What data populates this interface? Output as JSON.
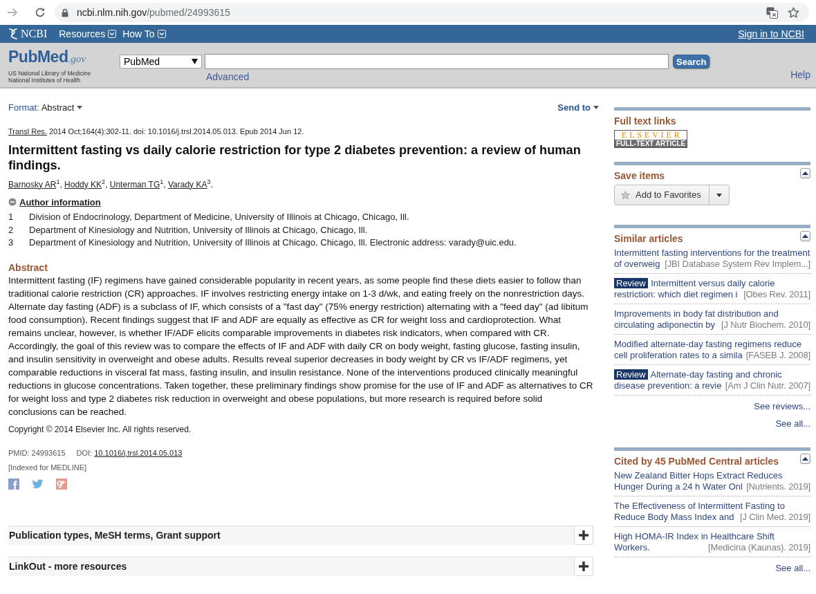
{
  "browser": {
    "forward": {
      "disabled": true
    },
    "address": {
      "host": "ncbi.nlm.nih.gov",
      "path": "/pubmed/24993615"
    }
  },
  "ncbi_bar": {
    "logo": "NCBI",
    "menus": [
      "Resources",
      "How To"
    ],
    "sign_in": "Sign in to NCBI"
  },
  "pubmed_header": {
    "logo": {
      "name": "PubMed",
      "suffix": ".gov",
      "lines": [
        "US National Library of Medicine",
        "National Institutes of Health"
      ]
    },
    "database": "PubMed",
    "search_button": "Search",
    "advanced": "Advanced",
    "help": "Help"
  },
  "toolbar": {
    "format_label": "Format:",
    "format_value": "Abstract",
    "send_to": "Send to"
  },
  "article": {
    "citation": {
      "journal": "Transl Res.",
      "details": "2014 Oct;164(4):302-11. doi: 10.1016/j.trsl.2014.05.013. Epub 2014 Jun 12."
    },
    "title": "Intermittent fasting vs daily calorie restriction for type 2 diabetes prevention: a review of human findings.",
    "authors": [
      {
        "name": "Barnosky AR",
        "affiliation": "1",
        "punctuation": ","
      },
      {
        "name": "Hoddy KK",
        "affiliation": "2",
        "punctuation": ","
      },
      {
        "name": "Unterman TG",
        "affiliation": "1",
        "punctuation": ","
      },
      {
        "name": "Varady KA",
        "affiliation": "3",
        "punctuation": "."
      }
    ],
    "author_information": {
      "label": "Author information",
      "expanded": true,
      "affiliations": [
        {
          "number": "1",
          "text": "Division of Endocrinology, Department of Medicine, University of Illinois at Chicago, Chicago, Ill."
        },
        {
          "number": "2",
          "text": "Department of Kinesiology and Nutrition, University of Illinois at Chicago, Chicago, Ill."
        },
        {
          "number": "3",
          "text": "Department of Kinesiology and Nutrition, University of Illinois at Chicago, Chicago, Ill. Electronic address: varady@uic.edu."
        }
      ]
    },
    "abstract": {
      "heading": "Abstract",
      "text": "Intermittent fasting (IF) regimens have gained considerable popularity in recent years, as some people find these diets easier to follow than traditional calorie restriction (CR) approaches. IF involves restricting energy intake on 1-3 d/wk, and eating freely on the nonrestriction days. Alternate day fasting (ADF) is a subclass of IF, which consists of a \"fast day\" (75% energy restriction) alternating with a \"feed day\" (ad libitum food consumption). Recent findings suggest that IF and ADF are equally as effective as CR for weight loss and cardioprotection. What remains unclear, however, is whether IF/ADF elicits comparable improvements in diabetes risk indicators, when compared with CR. Accordingly, the goal of this review was to compare the effects of IF and ADF with daily CR on body weight, fasting glucose, fasting insulin, and insulin sensitivity in overweight and obese adults. Results reveal superior decreases in body weight by CR vs IF/ADF regimens, yet comparable reductions in visceral fat mass, fasting insulin, and insulin resistance. None of the interventions produced clinically meaningful reductions in glucose concentrations. Taken together, these preliminary findings show promise for the use of IF and ADF as alternatives to CR for weight loss and type 2 diabetes risk reduction in overweight and obese populations, but more research is required before solid conclusions can be reached."
    },
    "copyright": "Copyright © 2014 Elsevier Inc. All rights reserved.",
    "pmid": "PMID: 24993615",
    "doi": {
      "label": "DOI:",
      "value": "10.1016/j.trsl.2014.05.013"
    },
    "indexed": "[Indexed for MEDLINE]"
  },
  "sections": [
    {
      "title": "Publication types, MeSH terms, Grant support",
      "expanded": false
    },
    {
      "title": "LinkOut - more resources",
      "expanded": false
    }
  ],
  "sidebar": {
    "full_text": {
      "heading": "Full text links",
      "publisher": "ELSEVIER",
      "caption": "FULL-TEXT ARTICLE"
    },
    "save_items": {
      "heading": "Save items",
      "expanded": true,
      "button": "Add to Favorites"
    },
    "similar": {
      "heading": "Similar articles",
      "expanded": true,
      "items": [
        {
          "title": "Intermittent fasting interventions for the treatment of overweig",
          "source": "[JBI Database System Rev Implem...]"
        },
        {
          "badge": "Review",
          "title": "Intermittent versus daily calorie restriction: which diet regimen i",
          "source": "[Obes Rev. 2011]"
        },
        {
          "title": "Improvements in body fat distribution and circulating adiponectin by",
          "source": "[J Nutr Biochem. 2010]"
        },
        {
          "title": "Modified alternate-day fasting regimens reduce cell proliferation rates to a simila",
          "source": "[FASEB J. 2008]"
        },
        {
          "badge": "Review",
          "title": "Alternate-day fasting and chronic disease prevention: a revie",
          "source": "[Am J Clin Nutr. 2007]"
        }
      ],
      "links": [
        "See reviews...",
        "See all..."
      ]
    },
    "cited": {
      "heading": "Cited by 45 PubMed Central articles",
      "expanded": true,
      "items": [
        {
          "title": "New Zealand Bitter Hops Extract Reduces Hunger During a 24 h Water Onl",
          "source": "[Nutrients. 2019]"
        },
        {
          "title": "The Effectiveness of Intermittent Fasting to Reduce Body Mass Index and",
          "source": "[J Clin Med. 2019]"
        },
        {
          "title": "High HOMA-IR Index in Healthcare Shift Workers.",
          "source": "[Medicina (Kaunas). 2019]"
        }
      ],
      "links": [
        "See all..."
      ]
    }
  }
}
